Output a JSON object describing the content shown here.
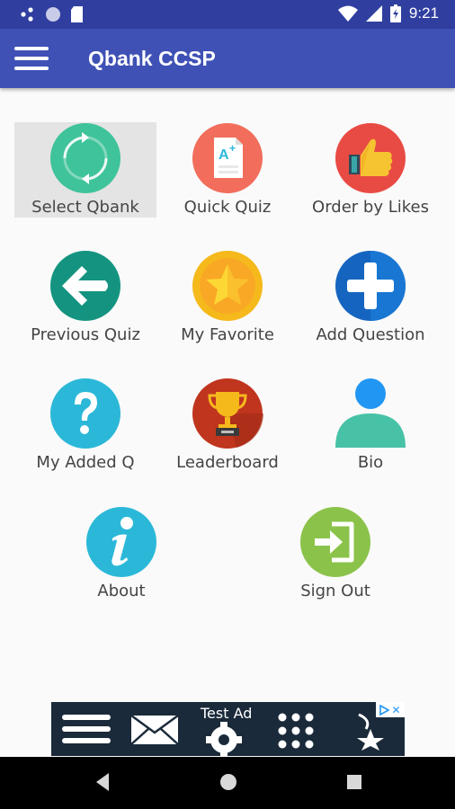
{
  "status_bar": {
    "time": "9:21",
    "icons": [
      "notification-dots-icon",
      "circle-icon",
      "sd-card-icon",
      "wifi-icon",
      "signal-icon",
      "battery-icon"
    ]
  },
  "app_bar": {
    "title": "Qbank CCSP",
    "menu_icon": "hamburger-menu-icon"
  },
  "menu": {
    "items": [
      {
        "label": "Select Qbank",
        "icon": "refresh-icon",
        "color": "#3fc39a",
        "selected": true
      },
      {
        "label": "Quick Quiz",
        "icon": "quiz-paper-icon",
        "color": "#f26d5b"
      },
      {
        "label": "Order by Likes",
        "icon": "thumbs-up-icon",
        "color": "#e84b43"
      },
      {
        "label": "Previous Quiz",
        "icon": "back-arrow-icon",
        "color": "#149480"
      },
      {
        "label": "My Favorite",
        "icon": "star-icon",
        "color": "#f5b91c"
      },
      {
        "label": "Add Question",
        "icon": "plus-icon",
        "color": "#1976d2"
      },
      {
        "label": "My Added Q",
        "icon": "question-mark-icon",
        "color": "#2bb8d8"
      },
      {
        "label": "Leaderboard",
        "icon": "trophy-icon",
        "color": "#c0351e"
      },
      {
        "label": "Bio",
        "icon": "person-icon",
        "color": "#47c2a6"
      },
      {
        "label": "About",
        "icon": "info-icon",
        "color": "#2bb8d8"
      },
      {
        "label": "Sign Out",
        "icon": "sign-out-icon",
        "color": "#8bc34a"
      }
    ]
  },
  "ad": {
    "label": "Test Ad",
    "icons": [
      "menu-icon",
      "envelope-icon",
      "gear-icon",
      "grid-icon",
      "star-icon",
      "adchoices-icon"
    ]
  },
  "nav_bar": {
    "buttons": [
      "back-icon",
      "home-icon",
      "recents-icon"
    ]
  }
}
